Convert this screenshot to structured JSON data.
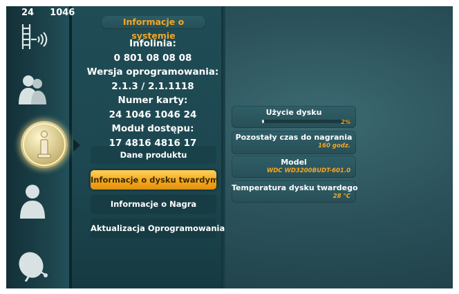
{
  "channel": {
    "number": "24",
    "name": "1046"
  },
  "sidebar": {
    "icons": [
      "antenna-icon",
      "family-icon",
      "info-icon",
      "person-icon",
      "satellite-dish-icon"
    ],
    "active": "info-icon"
  },
  "panel": {
    "title": "Informacje o systemie",
    "info_lines": [
      "Infolinia:",
      "0 801 08 08 08",
      "Wersja oprogramowania:",
      "2.1.3 / 2.1.1118",
      "Numer karty:",
      "24 1046 1046 24",
      "Moduł dostępu:",
      "17 4816 4816 17"
    ],
    "menu": [
      {
        "label": "Dane produktu",
        "selected": false
      },
      {
        "label": "Informacje o dysku twardym",
        "selected": true
      },
      {
        "label": "Informacje o Nagra",
        "selected": false
      },
      {
        "label": "Aktualizacja Oprogramowania",
        "selected": false
      }
    ]
  },
  "disk": {
    "usage": {
      "label": "Użycie dysku",
      "percent_text": "2%",
      "fraction": 0.02
    },
    "remaining": {
      "label": "Pozostały czas do nagrania",
      "value": "160 godz."
    },
    "model": {
      "label": "Model",
      "value": "WDC WD3200BUDT-601.0"
    },
    "temperature": {
      "label": "Temperatura dysku twardego",
      "value": "28 °C"
    }
  },
  "colors": {
    "accent": "#f5a623",
    "background": "#2a5059",
    "selected": "#f5a81f"
  }
}
